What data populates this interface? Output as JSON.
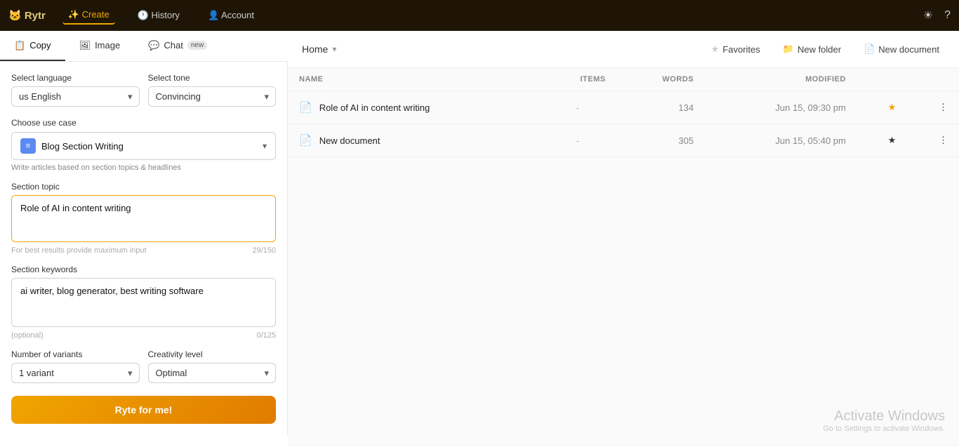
{
  "nav": {
    "logo": "🐱 Rytr",
    "items": [
      {
        "label": "✨ Create",
        "active": true
      },
      {
        "label": "🕐 History",
        "active": false
      },
      {
        "label": "👤 Account",
        "active": false
      }
    ],
    "icons": {
      "sun": "☀",
      "help": "?"
    }
  },
  "subnav": {
    "tabs": [
      {
        "label": "Copy",
        "icon": "📋",
        "active": true,
        "badge": ""
      },
      {
        "label": "Image",
        "icon": "🖼",
        "active": false,
        "badge": ""
      },
      {
        "label": "Chat",
        "icon": "💬",
        "active": false,
        "badge": "new"
      }
    ]
  },
  "leftPanel": {
    "selectLanguageLabel": "Select language",
    "languageValue": "us English",
    "selectToneLabel": "Select tone",
    "toneValue": "Convincing",
    "useCaseLabel": "Choose use case",
    "useCaseValue": "Blog Section Writing",
    "useCaseDesc": "Write articles based on section topics & headlines",
    "sectionTopicLabel": "Section topic",
    "sectionTopicValue": "Role of AI in content writing",
    "sectionTopicPlaceholder": "Role of AI in content writing",
    "sectionTopicHint": "For best results provide maximum input",
    "sectionTopicCount": "29/150",
    "sectionKeywordsLabel": "Section keywords",
    "sectionKeywordsValue": "ai writer, blog generator, best writing software",
    "sectionKeywordsPlaceholder": "ai writer, blog generator, best writing software",
    "sectionKeywordsOptional": "(optional)",
    "sectionKeywordsCount": "0/125",
    "variantsLabel": "Number of variants",
    "variantsValue": "1 variant",
    "creativityLabel": "Creativity level",
    "creativityValue": "Optimal",
    "generateLabel": "Ryte for me!"
  },
  "rightPanel": {
    "breadcrumb": "Home",
    "breadcrumbChevron": "▾",
    "actions": {
      "favorites": "Favorites",
      "newFolder": "New folder",
      "newDocument": "New document"
    },
    "table": {
      "columns": [
        "NAME",
        "ITEMS",
        "WORDS",
        "MODIFIED"
      ],
      "rows": [
        {
          "icon": "📄",
          "name": "Role of AI in content writing",
          "items": "-",
          "words": "134",
          "modified": "Jun 15, 09:30 pm",
          "starred": true
        },
        {
          "icon": "📄",
          "name": "New document",
          "items": "-",
          "words": "305",
          "modified": "Jun 15, 05:40 pm",
          "starred": false
        }
      ]
    }
  },
  "watermark": {
    "title": "Activate Windows",
    "subtitle": "Go to Settings to activate Windows."
  }
}
